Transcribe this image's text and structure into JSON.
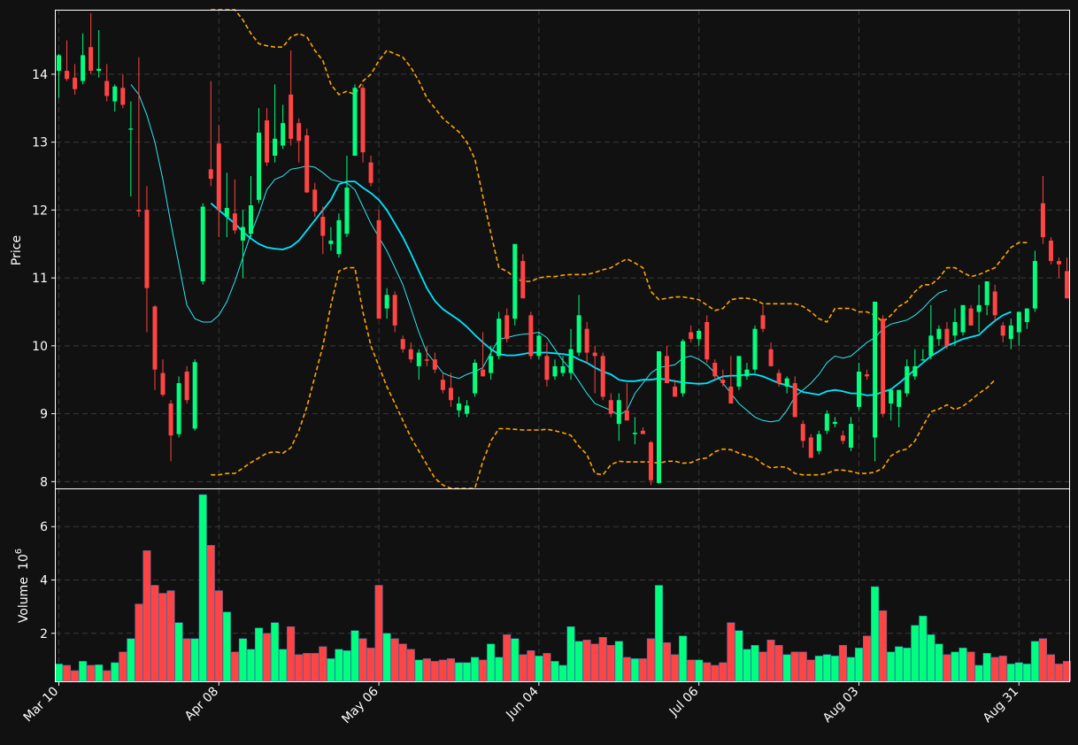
{
  "colors": {
    "background": "#111111",
    "up": "#00ff7f",
    "down": "#ff4444",
    "bb": "#ffa500",
    "ma_fast": "#2ee8f0",
    "ma_slow": "#00e5ff",
    "grid": "#3a3a3a",
    "frame": "#ffffff"
  },
  "price_panel": {
    "ylabel": "Price",
    "yticks": [
      8,
      9,
      10,
      11,
      12,
      13,
      14
    ],
    "ylim": [
      7.9,
      14.95
    ],
    "grid": true
  },
  "volume_panel": {
    "ylabel": "Volume",
    "yscale": "10",
    "yexp": "6",
    "yticks": [
      2,
      4,
      6
    ],
    "ylim": [
      0.2,
      7.4
    ],
    "grid": true
  },
  "xticks": [
    {
      "index": 0,
      "label": "Mar 10"
    },
    {
      "index": 20,
      "label": "Apr 08"
    },
    {
      "index": 40,
      "label": "May 06"
    },
    {
      "index": 60,
      "label": "Jun 04"
    },
    {
      "index": 80,
      "label": "Jul 06"
    },
    {
      "index": 100,
      "label": "Aug 03"
    },
    {
      "index": 120,
      "label": "Aug 31"
    }
  ],
  "chart_data": {
    "type": "candlestick",
    "candle_count": 127,
    "ohlc": [
      [
        14.05,
        14.3,
        13.65,
        14.28
      ],
      [
        14.05,
        14.5,
        13.9,
        13.93
      ],
      [
        13.95,
        14.15,
        13.7,
        13.78
      ],
      [
        13.9,
        14.6,
        13.85,
        14.28
      ],
      [
        14.4,
        14.9,
        14.0,
        14.05
      ],
      [
        14.05,
        14.65,
        13.95,
        14.08
      ],
      [
        13.9,
        14.15,
        13.6,
        13.68
      ],
      [
        13.6,
        13.85,
        13.45,
        13.82
      ],
      [
        13.8,
        14.0,
        13.5,
        13.55
      ],
      [
        13.2,
        13.6,
        12.2,
        13.2
      ],
      [
        12.0,
        14.25,
        11.9,
        11.98
      ],
      [
        12.0,
        12.35,
        10.2,
        10.85
      ],
      [
        10.58,
        10.6,
        9.35,
        9.65
      ],
      [
        9.6,
        9.8,
        9.25,
        9.28
      ],
      [
        9.15,
        9.2,
        8.3,
        8.68
      ],
      [
        8.7,
        9.55,
        8.65,
        9.45
      ],
      [
        9.62,
        9.7,
        9.15,
        9.2
      ],
      [
        8.78,
        9.8,
        8.75,
        9.76
      ],
      [
        10.95,
        12.1,
        10.9,
        12.05
      ],
      [
        12.6,
        13.9,
        12.35,
        12.46
      ],
      [
        12.98,
        13.25,
        11.6,
        12.0
      ],
      [
        11.9,
        12.55,
        11.6,
        12.03
      ],
      [
        11.95,
        12.45,
        11.65,
        11.7
      ],
      [
        11.55,
        12.0,
        11.0,
        11.75
      ],
      [
        11.65,
        12.5,
        11.6,
        12.07
      ],
      [
        12.15,
        13.5,
        12.1,
        13.14
      ],
      [
        13.32,
        13.5,
        12.65,
        12.7
      ],
      [
        12.8,
        13.85,
        12.7,
        13.05
      ],
      [
        12.95,
        13.55,
        12.9,
        13.28
      ],
      [
        13.7,
        14.35,
        12.95,
        13.05
      ],
      [
        13.28,
        13.35,
        12.7,
        13.02
      ],
      [
        13.1,
        13.2,
        12.25,
        12.26
      ],
      [
        12.3,
        12.4,
        11.9,
        11.98
      ],
      [
        11.9,
        12.05,
        11.35,
        11.62
      ],
      [
        11.5,
        11.75,
        11.4,
        11.55
      ],
      [
        11.35,
        11.95,
        11.3,
        11.85
      ],
      [
        11.65,
        12.8,
        11.6,
        12.33
      ],
      [
        12.8,
        13.85,
        12.8,
        13.8
      ],
      [
        13.8,
        13.85,
        12.7,
        12.85
      ],
      [
        12.7,
        12.8,
        12.35,
        12.4
      ],
      [
        11.85,
        12.0,
        10.4,
        10.4
      ],
      [
        10.55,
        10.85,
        10.4,
        10.75
      ],
      [
        10.75,
        10.8,
        10.2,
        10.3
      ],
      [
        10.1,
        10.15,
        9.9,
        9.95
      ],
      [
        9.95,
        10.05,
        9.75,
        9.8
      ],
      [
        9.7,
        9.95,
        9.5,
        9.9
      ],
      [
        9.8,
        10.0,
        9.7,
        9.78
      ],
      [
        9.8,
        9.9,
        9.6,
        9.65
      ],
      [
        9.5,
        9.6,
        9.3,
        9.35
      ],
      [
        9.38,
        9.6,
        9.1,
        9.2
      ],
      [
        9.05,
        9.25,
        8.95,
        9.15
      ],
      [
        9.0,
        9.2,
        8.95,
        9.12
      ],
      [
        9.3,
        9.8,
        9.25,
        9.75
      ],
      [
        9.65,
        10.2,
        9.55,
        9.55
      ],
      [
        9.6,
        10.0,
        9.5,
        9.85
      ],
      [
        9.85,
        10.5,
        9.8,
        10.4
      ],
      [
        10.45,
        10.55,
        10.05,
        10.1
      ],
      [
        10.4,
        11.5,
        10.3,
        11.5
      ],
      [
        11.25,
        11.35,
        10.7,
        10.7
      ],
      [
        10.45,
        10.5,
        9.8,
        9.85
      ],
      [
        9.85,
        10.2,
        9.8,
        10.15
      ],
      [
        9.85,
        10.05,
        9.4,
        9.5
      ],
      [
        9.55,
        9.8,
        9.5,
        9.7
      ],
      [
        9.6,
        9.85,
        9.55,
        9.7
      ],
      [
        9.6,
        10.25,
        9.5,
        9.95
      ],
      [
        9.9,
        10.75,
        9.85,
        10.45
      ],
      [
        10.25,
        10.35,
        9.75,
        9.9
      ],
      [
        9.9,
        10.0,
        9.3,
        9.85
      ],
      [
        9.85,
        9.9,
        9.2,
        9.25
      ],
      [
        9.2,
        9.3,
        8.95,
        9.0
      ],
      [
        8.85,
        9.3,
        8.6,
        9.2
      ],
      [
        9.05,
        9.45,
        8.95,
        8.9
      ],
      [
        8.7,
        8.95,
        8.55,
        8.72
      ],
      [
        8.75,
        8.8,
        8.7,
        8.7
      ],
      [
        8.58,
        8.6,
        7.95,
        8.02
      ],
      [
        7.98,
        9.92,
        7.97,
        9.92
      ],
      [
        9.85,
        10.0,
        9.45,
        9.45
      ],
      [
        9.4,
        9.5,
        9.3,
        9.25
      ],
      [
        9.3,
        10.1,
        9.25,
        10.07
      ],
      [
        10.2,
        10.3,
        10.05,
        10.1
      ],
      [
        10.1,
        10.25,
        10.0,
        10.22
      ],
      [
        10.35,
        10.45,
        9.75,
        9.8
      ],
      [
        9.75,
        9.8,
        9.5,
        9.55
      ],
      [
        9.5,
        9.65,
        9.4,
        9.45
      ],
      [
        9.4,
        9.85,
        9.15,
        9.15
      ],
      [
        9.4,
        9.85,
        9.35,
        9.85
      ],
      [
        9.55,
        9.75,
        9.5,
        9.65
      ],
      [
        9.65,
        10.3,
        9.6,
        10.25
      ],
      [
        10.45,
        10.6,
        10.2,
        10.25
      ],
      [
        9.95,
        10.05,
        9.7,
        9.7
      ],
      [
        9.6,
        9.65,
        9.4,
        9.45
      ],
      [
        9.4,
        9.55,
        9.3,
        9.52
      ],
      [
        9.45,
        9.55,
        9.05,
        8.95
      ],
      [
        8.85,
        8.9,
        8.5,
        8.6
      ],
      [
        8.65,
        8.7,
        8.35,
        8.35
      ],
      [
        8.45,
        8.75,
        8.4,
        8.7
      ],
      [
        8.75,
        9.05,
        8.7,
        9.0
      ],
      [
        8.85,
        8.95,
        8.8,
        8.88
      ],
      [
        8.68,
        8.75,
        8.55,
        8.6
      ],
      [
        8.5,
        8.95,
        8.45,
        8.85
      ],
      [
        9.1,
        9.75,
        9.05,
        9.62
      ],
      [
        9.58,
        9.65,
        9.5,
        9.55
      ],
      [
        8.65,
        10.65,
        8.3,
        10.65
      ],
      [
        10.4,
        10.45,
        8.95,
        9.0
      ],
      [
        9.15,
        9.3,
        8.9,
        9.35
      ],
      [
        9.1,
        9.35,
        8.8,
        9.35
      ],
      [
        9.3,
        9.8,
        9.25,
        9.7
      ],
      [
        9.55,
        9.95,
        9.5,
        9.7
      ],
      [
        9.8,
        9.95,
        9.78,
        9.8
      ],
      [
        9.85,
        10.6,
        9.8,
        10.15
      ],
      [
        10.1,
        10.3,
        10.0,
        10.25
      ],
      [
        10.25,
        10.35,
        9.95,
        10.0
      ],
      [
        10.15,
        10.55,
        10.0,
        10.35
      ],
      [
        10.2,
        10.5,
        10.15,
        10.6
      ],
      [
        10.55,
        10.6,
        10.3,
        10.3
      ],
      [
        10.5,
        10.9,
        10.2,
        10.6
      ],
      [
        10.6,
        10.95,
        10.45,
        10.95
      ],
      [
        10.8,
        10.9,
        10.35,
        10.45
      ],
      [
        10.3,
        10.35,
        10.05,
        10.15
      ],
      [
        10.1,
        10.4,
        9.95,
        10.3
      ],
      [
        10.2,
        10.4,
        10.0,
        10.5
      ],
      [
        10.35,
        10.55,
        10.25,
        10.55
      ],
      [
        10.55,
        11.4,
        10.5,
        11.25
      ],
      [
        12.1,
        12.5,
        11.5,
        11.6
      ],
      [
        11.55,
        11.6,
        11.2,
        11.25
      ],
      [
        11.25,
        11.3,
        11.0,
        11.2
      ],
      [
        11.1,
        11.3,
        10.7,
        10.7
      ]
    ],
    "volume": [
      0.85,
      0.8,
      0.6,
      0.95,
      0.8,
      0.82,
      0.6,
      0.9,
      1.3,
      1.8,
      3.1,
      5.1,
      3.8,
      3.5,
      3.6,
      2.4,
      1.8,
      1.8,
      7.2,
      5.3,
      3.6,
      2.8,
      1.3,
      1.8,
      1.4,
      2.2,
      2.0,
      2.4,
      1.4,
      2.25,
      1.2,
      1.25,
      1.25,
      1.5,
      1.05,
      1.4,
      1.35,
      2.1,
      1.8,
      1.45,
      3.8,
      2.0,
      1.8,
      1.6,
      1.4,
      1.0,
      1.05,
      0.95,
      1.0,
      1.05,
      0.9,
      0.9,
      1.1,
      1.0,
      1.6,
      1.1,
      1.95,
      1.8,
      1.2,
      1.35,
      1.15,
      1.25,
      0.95,
      0.8,
      2.25,
      1.7,
      1.75,
      1.6,
      1.85,
      1.55,
      1.7,
      1.1,
      1.05,
      1.05,
      1.8,
      3.8,
      1.65,
      1.2,
      1.9,
      1.0,
      1.0,
      0.9,
      0.8,
      0.9,
      2.4,
      2.1,
      1.4,
      1.55,
      1.3,
      1.75,
      1.55,
      1.2,
      1.3,
      1.3,
      1.0,
      1.15,
      1.2,
      1.15,
      1.55,
      1.1,
      1.45,
      1.9,
      3.75,
      2.85,
      1.3,
      1.5,
      1.45,
      2.3,
      2.65,
      1.95,
      1.6,
      1.2,
      1.3,
      1.45,
      1.3,
      0.8,
      1.25,
      1.1,
      1.15,
      0.85,
      0.9,
      0.85,
      1.7,
      1.8,
      1.2,
      0.85,
      0.95
    ],
    "volume_unit": "10^6",
    "overlays": [
      {
        "name": "ma_fast",
        "color": "#2ee8f0",
        "start": 9,
        "values": [
          13.85,
          13.7,
          13.4,
          13.0,
          12.45,
          11.8,
          11.2,
          10.6,
          10.4,
          10.35,
          10.35,
          10.45,
          10.65,
          10.95,
          11.3,
          11.65,
          11.95,
          12.3,
          12.45,
          12.5,
          12.6,
          12.62,
          12.65,
          12.63,
          12.55,
          12.45,
          12.42,
          12.4,
          12.3,
          12.05,
          11.8,
          11.6,
          11.4,
          11.15,
          10.9,
          10.55,
          10.2,
          9.9,
          9.75,
          9.6,
          9.55,
          9.52,
          9.58,
          9.62,
          9.68,
          9.9,
          10.1,
          10.12,
          10.15,
          10.17,
          10.18,
          10.2,
          10.12,
          9.95,
          9.78,
          9.65,
          9.48,
          9.3,
          9.15,
          9.1,
          9.05,
          8.98,
          9.05,
          9.3,
          9.45,
          9.6,
          9.68,
          9.7,
          9.72,
          9.82,
          9.85,
          9.8,
          9.72,
          9.6,
          9.45,
          9.3,
          9.15,
          9.05,
          8.95,
          8.9,
          8.88,
          8.9,
          9.05,
          9.25,
          9.35,
          9.45,
          9.58,
          9.75,
          9.85,
          9.82,
          9.85,
          9.95,
          10.05,
          10.12,
          10.25,
          10.32,
          10.35,
          10.38,
          10.45,
          10.55,
          10.68,
          10.78,
          10.82
        ]
      },
      {
        "name": "ma_slow",
        "color": "#00e5ff",
        "start": 19,
        "values": [
          12.1,
          12.0,
          11.9,
          11.8,
          11.68,
          11.58,
          11.5,
          11.45,
          11.43,
          11.42,
          11.46,
          11.55,
          11.7,
          11.85,
          12.0,
          12.15,
          12.38,
          12.42,
          12.42,
          12.33,
          12.25,
          12.15,
          12.0,
          11.8,
          11.6,
          11.36,
          11.1,
          10.85,
          10.66,
          10.54,
          10.46,
          10.38,
          10.28,
          10.16,
          10.05,
          9.95,
          9.88,
          9.86,
          9.86,
          9.88,
          9.9,
          9.9,
          9.9,
          9.89,
          9.88,
          9.86,
          9.8,
          9.75,
          9.68,
          9.62,
          9.58,
          9.5,
          9.48,
          9.48,
          9.5,
          9.5,
          9.52,
          9.5,
          9.48,
          9.46,
          9.45,
          9.44,
          9.45,
          9.5,
          9.55,
          9.56,
          9.56,
          9.58,
          9.58,
          9.55,
          9.5,
          9.45,
          9.42,
          9.38,
          9.32,
          9.3,
          9.28,
          9.33,
          9.35,
          9.33,
          9.3,
          9.3,
          9.27,
          9.28,
          9.32,
          9.36,
          9.45,
          9.55,
          9.65,
          9.75,
          9.85,
          9.92,
          10.0,
          10.05,
          10.1,
          10.13,
          10.16,
          10.27,
          10.37,
          10.45,
          10.5
        ]
      },
      {
        "name": "bb_upper",
        "color": "#ffa500",
        "start": 19,
        "values": [
          15.8,
          15.5,
          15.25,
          15.0,
          14.8,
          14.6,
          14.45,
          14.42,
          14.4,
          14.4,
          14.55,
          14.6,
          14.55,
          14.35,
          14.2,
          13.85,
          13.7,
          13.75,
          13.7,
          13.9,
          14.0,
          14.2,
          14.35,
          14.3,
          14.25,
          14.1,
          13.9,
          13.65,
          13.5,
          13.35,
          13.25,
          13.15,
          13.0,
          12.75,
          12.2,
          11.65,
          11.15,
          11.1,
          11.0,
          10.95,
          10.95,
          11.0,
          11.02,
          11.02,
          11.04,
          11.05,
          11.05,
          11.05,
          11.08,
          11.12,
          11.15,
          11.22,
          11.28,
          11.22,
          11.15,
          10.8,
          10.68,
          10.7,
          10.72,
          10.72,
          10.7,
          10.68,
          10.6,
          10.52,
          10.55,
          10.68,
          10.7,
          10.7,
          10.68,
          10.62,
          10.62,
          10.62,
          10.62,
          10.62,
          10.58,
          10.5,
          10.4,
          10.35,
          10.55,
          10.55,
          10.55,
          10.5,
          10.5,
          10.45,
          10.35,
          10.45,
          10.58,
          10.65,
          10.8,
          10.9,
          10.9,
          11.0,
          11.15,
          11.15,
          11.08,
          11.02,
          11.05,
          11.1,
          11.15,
          11.3,
          11.45,
          11.52,
          11.52
        ]
      },
      {
        "name": "bb_lower",
        "color": "#ffa500",
        "start": 19,
        "values": [
          8.1,
          8.1,
          8.12,
          8.12,
          8.2,
          8.28,
          8.35,
          8.42,
          8.44,
          8.42,
          8.5,
          8.75,
          9.1,
          9.55,
          10.0,
          10.6,
          11.1,
          11.15,
          11.15,
          10.5,
          10.0,
          9.7,
          9.4,
          9.15,
          8.9,
          8.65,
          8.45,
          8.25,
          8.05,
          7.95,
          7.8,
          7.65,
          7.6,
          7.9,
          8.3,
          8.6,
          8.78,
          8.78,
          8.77,
          8.76,
          8.76,
          8.76,
          8.77,
          8.75,
          8.72,
          8.68,
          8.52,
          8.4,
          8.12,
          8.1,
          8.25,
          8.3,
          8.29,
          8.29,
          8.29,
          8.29,
          8.27,
          8.3,
          8.3,
          8.27,
          8.28,
          8.33,
          8.35,
          8.44,
          8.48,
          8.47,
          8.42,
          8.38,
          8.35,
          8.26,
          8.2,
          8.22,
          8.21,
          8.12,
          8.1,
          8.1,
          8.1,
          8.12,
          8.17,
          8.17,
          8.15,
          8.12,
          8.12,
          8.14,
          8.2,
          8.38,
          8.45,
          8.48,
          8.6,
          8.82,
          9.03,
          9.07,
          9.13,
          9.06,
          9.11,
          9.2,
          9.3,
          9.38,
          9.5
        ]
      }
    ]
  }
}
